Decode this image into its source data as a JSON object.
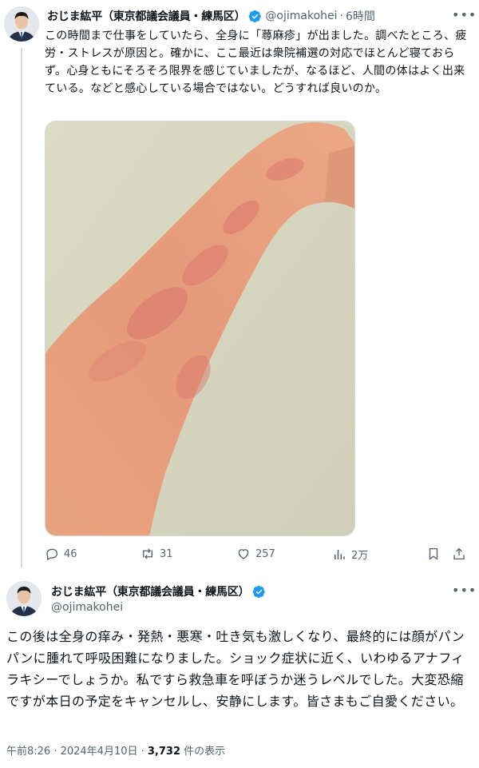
{
  "tweet1": {
    "display_name": "おじま紘平（東京都議会議員・練馬区）",
    "handle": "@ojimakohei",
    "time": "6時間",
    "text": "この時間まで仕事をしていたら、全身に「蕁麻疹」が出ました。調べたところ、疲労・ストレスが原因と。確かに、ここ最近は衆院補選の対応でほとんど寝ておらず。心身ともにそろそろ限界を感じていましたが、なるほど、人間の体はよく出来ている。などと感心している場合ではない。どうすれば良いのか。",
    "actions": {
      "replies": "46",
      "reposts": "31",
      "likes": "257",
      "views": "2万"
    }
  },
  "tweet2": {
    "display_name": "おじま紘平（東京都議会議員・練馬区）",
    "handle": "@ojimakohei",
    "text": "この後は全身の痒み・発熱・悪寒・吐き気も激しくなり、最終的には顔がパンパンに腫れて呼吸困難になりました。ショック症状に近く、いわゆるアナフィラキシーでしょうか。私ですら救急車を呼ぼうか迷うレベルでした。大変恐縮ですが本日の予定をキャンセルし、安静にします。皆さまもご自愛ください。",
    "timestamp": "午前8:26 · 2024年4月10日 · ",
    "views_count": "3,732",
    "views_label": " 件の表示"
  },
  "icons": {
    "verified": "verified-badge-icon",
    "more": "more-icon",
    "reply": "reply-icon",
    "repost": "repost-icon",
    "like": "heart-icon",
    "views": "views-icon",
    "bookmark": "bookmark-icon",
    "share": "share-icon"
  },
  "colors": {
    "verified_blue": "#1d9bf0",
    "secondary_text": "#536471",
    "primary_text": "#0f1419",
    "divider": "#cfd9de"
  }
}
